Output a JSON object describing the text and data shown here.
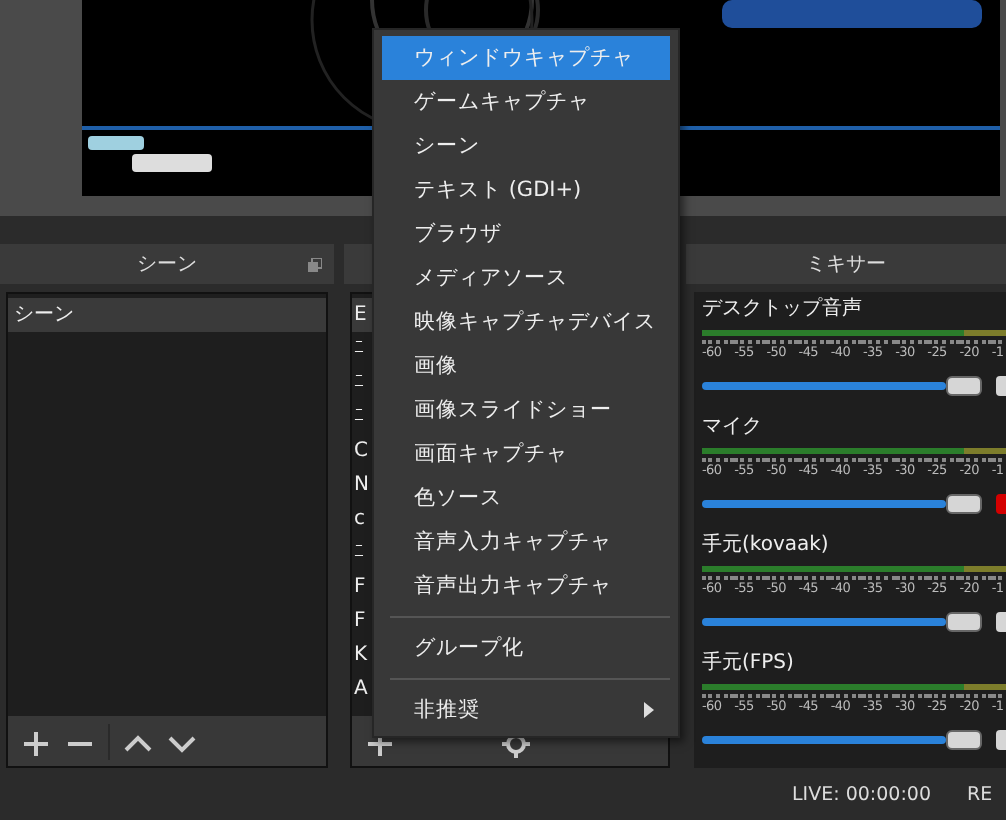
{
  "scenes": {
    "title": "シーン",
    "items": [
      {
        "label": "シーン",
        "selected": true
      }
    ]
  },
  "sources": {
    "items": [
      {
        "label": "E",
        "selected": true
      },
      {
        "label": "ﾆ",
        "selected": false
      },
      {
        "label": "ﾆ",
        "selected": false
      },
      {
        "label": "ﾆ",
        "selected": false
      },
      {
        "label": "C",
        "selected": false
      },
      {
        "label": "N",
        "selected": false
      },
      {
        "label": "c",
        "selected": false
      },
      {
        "label": "ﾆ",
        "selected": false
      },
      {
        "label": "F",
        "selected": false
      },
      {
        "label": "F",
        "selected": false
      },
      {
        "label": "K",
        "selected": false
      },
      {
        "label": "A",
        "selected": false
      }
    ]
  },
  "mixer": {
    "title": "ミキサー",
    "channels": [
      {
        "name": "デスクトップ音声",
        "level": 1,
        "muted": false,
        "ticks": [
          "-60",
          "-55",
          "-50",
          "-45",
          "-40",
          "-35",
          "-30",
          "-25",
          "-20",
          "-1"
        ]
      },
      {
        "name": "マイク",
        "level": 1,
        "muted": true,
        "ticks": [
          "-60",
          "-55",
          "-50",
          "-45",
          "-40",
          "-35",
          "-30",
          "-25",
          "-20",
          "-1"
        ]
      },
      {
        "name": "手元(kovaak)",
        "level": 1,
        "muted": false,
        "ticks": [
          "-60",
          "-55",
          "-50",
          "-45",
          "-40",
          "-35",
          "-30",
          "-25",
          "-20",
          "-1"
        ]
      },
      {
        "name": "手元(FPS)",
        "level": 1,
        "muted": false,
        "ticks": [
          "-60",
          "-55",
          "-50",
          "-45",
          "-40",
          "-35",
          "-30",
          "-25",
          "-20",
          "-1"
        ]
      }
    ]
  },
  "menu": {
    "items": [
      {
        "kind": "item",
        "label": "ウィンドウキャプチャ",
        "selected": true
      },
      {
        "kind": "item",
        "label": "ゲームキャプチャ",
        "selected": false
      },
      {
        "kind": "item",
        "label": "シーン",
        "selected": false
      },
      {
        "kind": "item",
        "label": "テキスト (GDI+)",
        "selected": false
      },
      {
        "kind": "item",
        "label": "ブラウザ",
        "selected": false
      },
      {
        "kind": "item",
        "label": "メディアソース",
        "selected": false
      },
      {
        "kind": "item",
        "label": "映像キャプチャデバイス",
        "selected": false
      },
      {
        "kind": "item",
        "label": "画像",
        "selected": false
      },
      {
        "kind": "item",
        "label": "画像スライドショー",
        "selected": false
      },
      {
        "kind": "item",
        "label": "画面キャプチャ",
        "selected": false
      },
      {
        "kind": "item",
        "label": "色ソース",
        "selected": false
      },
      {
        "kind": "item",
        "label": "音声入力キャプチャ",
        "selected": false
      },
      {
        "kind": "item",
        "label": "音声出力キャプチャ",
        "selected": false
      },
      {
        "kind": "separator"
      },
      {
        "kind": "item",
        "label": "グループ化",
        "selected": false
      },
      {
        "kind": "separator"
      },
      {
        "kind": "submenu",
        "label": "非推奨",
        "selected": false
      }
    ]
  },
  "status_bar": {
    "live": "LIVE: 00:00:00",
    "rec": "RE"
  }
}
